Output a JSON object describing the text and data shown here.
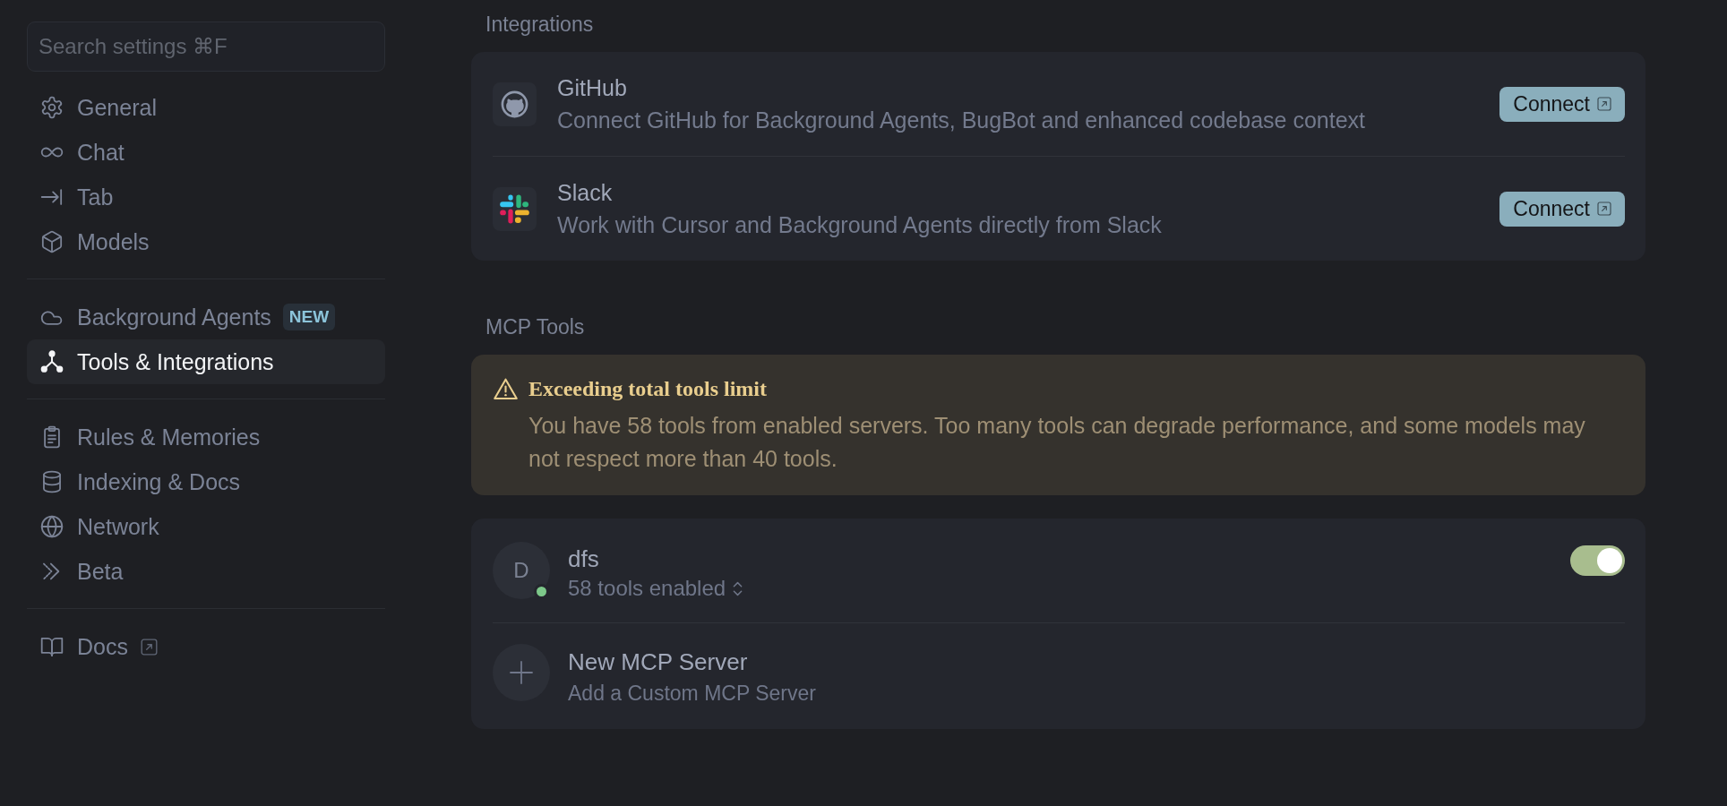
{
  "sidebar": {
    "search": {
      "placeholder": "Search settings ⌘F"
    },
    "groups": [
      {
        "items": [
          {
            "label": "General",
            "selected": false,
            "external": false
          },
          {
            "label": "Chat",
            "selected": false,
            "external": false
          },
          {
            "label": "Tab",
            "selected": false,
            "external": false
          },
          {
            "label": "Models",
            "selected": false,
            "external": false
          }
        ]
      },
      {
        "items": [
          {
            "label": "Background Agents",
            "badge": "NEW",
            "selected": false,
            "external": false
          },
          {
            "label": "Tools & Integrations",
            "selected": true,
            "external": false
          }
        ]
      },
      {
        "items": [
          {
            "label": "Rules & Memories",
            "selected": false,
            "external": false
          },
          {
            "label": "Indexing & Docs",
            "selected": false,
            "external": false
          },
          {
            "label": "Network",
            "selected": false,
            "external": false
          },
          {
            "label": "Beta",
            "selected": false,
            "external": false
          }
        ]
      },
      {
        "items": [
          {
            "label": "Docs",
            "selected": false,
            "external": true
          }
        ]
      }
    ]
  },
  "integrations": {
    "title": "Integrations",
    "items": [
      {
        "name": "GitHub",
        "description": "Connect GitHub for Background Agents, BugBot and enhanced codebase context",
        "button": "Connect"
      },
      {
        "name": "Slack",
        "description": "Work with Cursor and Background Agents directly from Slack",
        "button": "Connect"
      }
    ]
  },
  "mcp_tools": {
    "title": "MCP Tools",
    "warning": {
      "title": "Exceeding total tools limit",
      "message": "You have 58 tools from enabled servers. Too many tools can degrade performance, and some models may not respect more than 40 tools."
    },
    "servers": [
      {
        "kind": "server",
        "avatar": "D",
        "name": "dfs",
        "color": "#7dc88a",
        "tools": "58 tools enabled",
        "on": true
      },
      {
        "kind": "add",
        "name": "New MCP Server",
        "description": "Add a Custom MCP Server"
      }
    ]
  }
}
